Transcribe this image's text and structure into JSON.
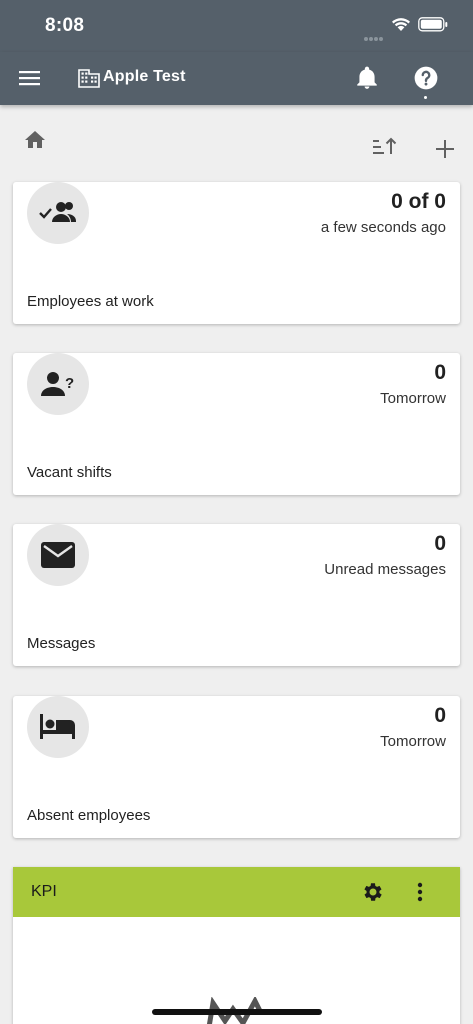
{
  "status_bar": {
    "time": "8:08"
  },
  "app_bar": {
    "title": "Apple Test"
  },
  "cards": [
    {
      "value": "0 of 0",
      "subtitle": "a few seconds ago",
      "label": "Employees at work",
      "icon": "people-check-icon"
    },
    {
      "value": "0",
      "subtitle": "Tomorrow",
      "label": "Vacant shifts",
      "icon": "person-question-icon"
    },
    {
      "value": "0",
      "subtitle": "Unread messages",
      "label": "Messages",
      "icon": "mail-icon"
    },
    {
      "value": "0",
      "subtitle": "Tomorrow",
      "label": "Absent employees",
      "icon": "bed-icon"
    }
  ],
  "kpi": {
    "title": "KPI",
    "header_color": "#a8c83a"
  },
  "colors": {
    "appbar": "#55606a",
    "background": "#efefef"
  }
}
